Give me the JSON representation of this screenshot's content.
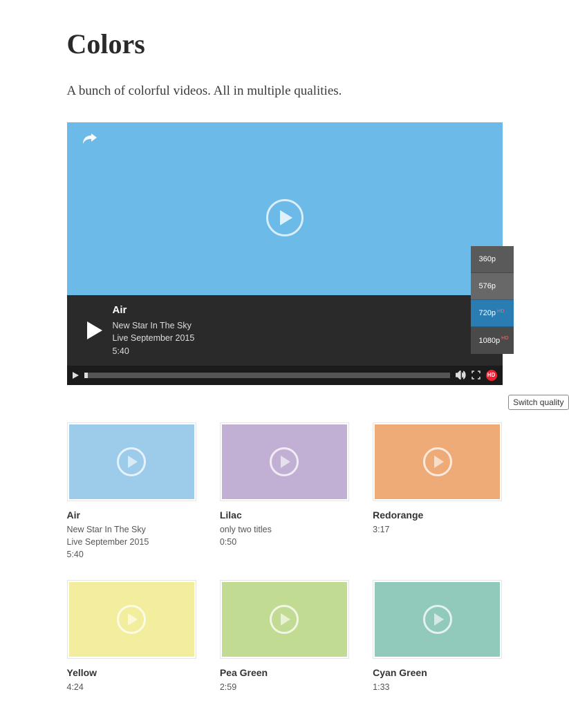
{
  "page": {
    "title": "Colors",
    "desc": "A bunch of colorful videos. All in multiple qualities."
  },
  "player": {
    "color": "#6cbae8",
    "title": "Air",
    "sub1": "New Star In The Sky",
    "sub2": "Live September 2015",
    "duration": "5:40",
    "quality": [
      {
        "label": "360p",
        "hd": false,
        "active": false,
        "cls": "dark1"
      },
      {
        "label": "576p",
        "hd": false,
        "active": false,
        "cls": "dark2"
      },
      {
        "label": "720p",
        "hd": true,
        "active": true,
        "cls": ""
      },
      {
        "label": "1080p",
        "hd": true,
        "active": false,
        "cls": "dark3"
      }
    ],
    "tooltip": "Switch quality",
    "hd_label": "HD"
  },
  "videos": [
    {
      "title": "Air",
      "subs": [
        "New Star In The Sky",
        "Live September 2015"
      ],
      "time": "5:40",
      "color": "#9dcceb"
    },
    {
      "title": "Lilac",
      "subs": [
        "only two titles"
      ],
      "time": "0:50",
      "color": "#c1b0d4"
    },
    {
      "title": "Redorange",
      "subs": [],
      "time": "3:17",
      "color": "#eeab77"
    },
    {
      "title": "Yellow",
      "subs": [],
      "time": "4:24",
      "color": "#f2ee9d"
    },
    {
      "title": "Pea Green",
      "subs": [],
      "time": "2:59",
      "color": "#c2db93"
    },
    {
      "title": "Cyan Green",
      "subs": [],
      "time": "1:33",
      "color": "#91c9bb"
    }
  ]
}
